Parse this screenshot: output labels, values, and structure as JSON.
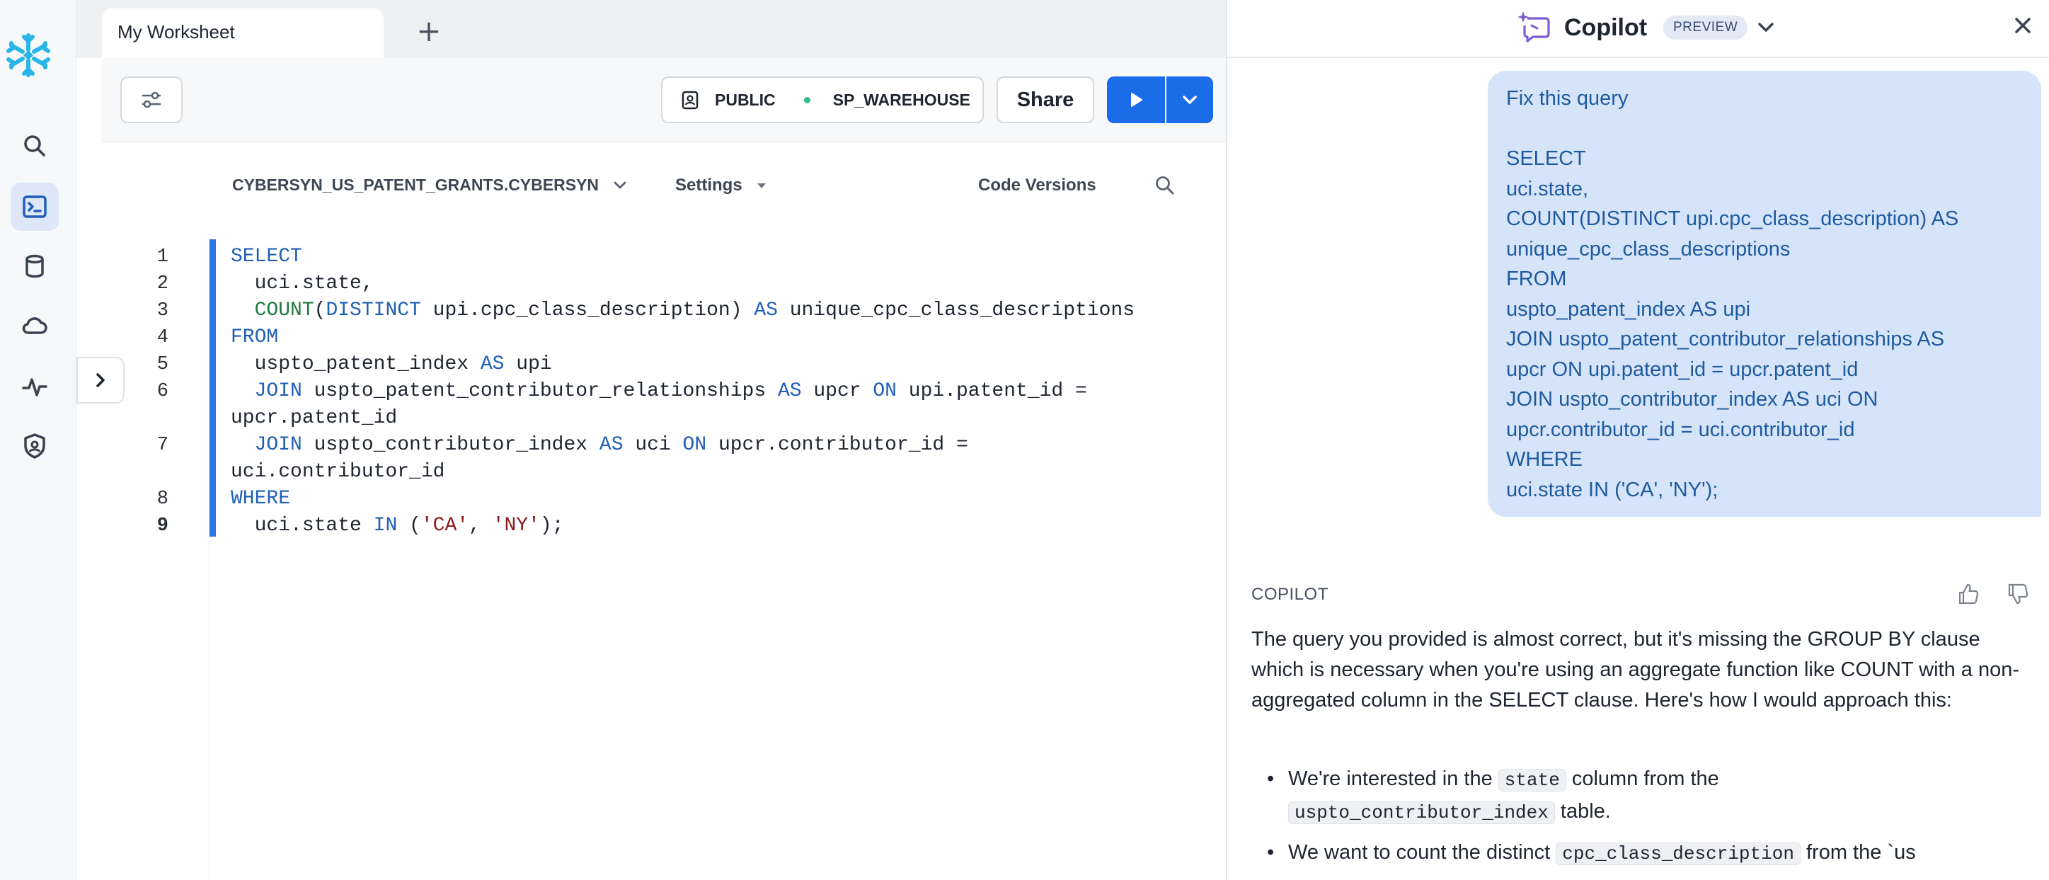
{
  "worksheet": {
    "tab_label": "My Worksheet",
    "add_tab_symbol": "+"
  },
  "toolbar": {
    "role": "PUBLIC",
    "warehouse": "SP_WAREHOUSE",
    "share_label": "Share"
  },
  "editor_bar": {
    "database": "CYBERSYN_US_PATENT_GRANTS.CYBERSYN",
    "settings_label": "Settings",
    "code_versions_label": "Code Versions"
  },
  "code": {
    "current_line": "9",
    "lines": [
      {
        "n": "1",
        "html_parts": [
          [
            "kw",
            "SELECT"
          ]
        ]
      },
      {
        "n": "2",
        "html_parts": [
          [
            "",
            "  uci.state,"
          ]
        ]
      },
      {
        "n": "3",
        "html_parts": [
          [
            "",
            "  "
          ],
          [
            "fn",
            "COUNT"
          ],
          [
            "",
            "("
          ],
          [
            "kw",
            "DISTINCT"
          ],
          [
            "",
            " upi.cpc_class_description) "
          ],
          [
            "kw",
            "AS"
          ],
          [
            "",
            " unique_cpc_class_descriptions"
          ]
        ]
      },
      {
        "n": "4",
        "html_parts": [
          [
            "kw",
            "FROM"
          ]
        ]
      },
      {
        "n": "5",
        "html_parts": [
          [
            "",
            "  uspto_patent_index "
          ],
          [
            "kw",
            "AS"
          ],
          [
            "",
            " upi"
          ]
        ]
      },
      {
        "n": "6",
        "html_parts": [
          [
            "",
            "  "
          ],
          [
            "kw",
            "JOIN"
          ],
          [
            "",
            " uspto_patent_contributor_relationships "
          ],
          [
            "kw",
            "AS"
          ],
          [
            "",
            " upcr "
          ],
          [
            "kw",
            "ON"
          ],
          [
            "",
            " upi.patent_id ="
          ]
        ]
      },
      {
        "n": "",
        "html_parts": [
          [
            "",
            "upcr.patent_id"
          ]
        ]
      },
      {
        "n": "7",
        "html_parts": [
          [
            "",
            "  "
          ],
          [
            "kw",
            "JOIN"
          ],
          [
            "",
            " uspto_contributor_index "
          ],
          [
            "kw",
            "AS"
          ],
          [
            "",
            " uci "
          ],
          [
            "kw",
            "ON"
          ],
          [
            "",
            " upcr.contributor_id ="
          ]
        ]
      },
      {
        "n": "",
        "html_parts": [
          [
            "",
            "uci.contributor_id"
          ]
        ]
      },
      {
        "n": "8",
        "html_parts": [
          [
            "kw",
            "WHERE"
          ]
        ]
      },
      {
        "n": "9",
        "html_parts": [
          [
            "",
            "  uci.state "
          ],
          [
            "kw",
            "IN"
          ],
          [
            "",
            " ("
          ],
          [
            "str",
            "'CA'"
          ],
          [
            "",
            ", "
          ],
          [
            "str",
            "'NY'"
          ],
          [
            "",
            ");"
          ]
        ]
      }
    ]
  },
  "copilot": {
    "title": "Copilot",
    "badge": "PREVIEW",
    "user_message": "Fix this query\n\nSELECT\nuci.state,\nCOUNT(DISTINCT upi.cpc_class_description) AS\nunique_cpc_class_descriptions\nFROM\nuspto_patent_index AS upi\nJOIN uspto_patent_contributor_relationships AS\nupcr ON upi.patent_id = upcr.patent_id\nJOIN uspto_contributor_index AS uci ON\nupcr.contributor_id = uci.contributor_id\nWHERE\nuci.state IN ('CA', 'NY');",
    "assistant_label": "COPILOT",
    "answer": "The query you provided is almost correct, but it's missing the GROUP BY clause which is necessary when you're using an aggregate function like COUNT with a non-aggregated column in the SELECT clause. Here's how I would approach this:",
    "bullet1": {
      "pre": "We're interested in the ",
      "code1": "state",
      "mid": " column from the",
      "code2": "uspto_contributor_index",
      "post": " table."
    },
    "bullet2": {
      "pre": "We want to count the distinct ",
      "code1": "cpc_class_description",
      "post": " from the `us"
    }
  }
}
